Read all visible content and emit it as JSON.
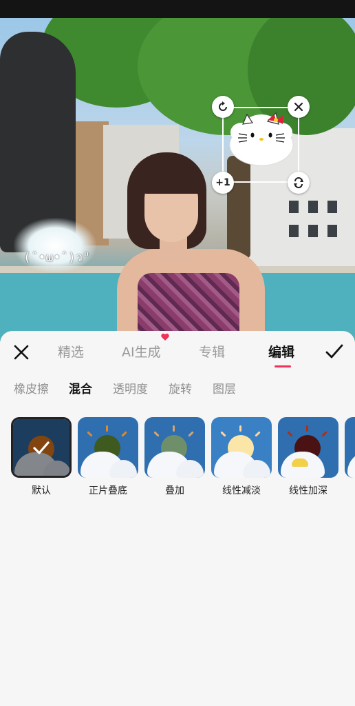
{
  "photo": {
    "kaomoji": "(ˆ•ω•ˆ)ว\""
  },
  "sticker": {
    "plus_label": "+1"
  },
  "main_tabs": [
    {
      "label": "精选",
      "active": false
    },
    {
      "label": "AI生成",
      "active": false,
      "badge": "heart"
    },
    {
      "label": "专辑",
      "active": false
    },
    {
      "label": "编辑",
      "active": true
    }
  ],
  "sub_tabs": [
    {
      "label": "橡皮擦",
      "active": false
    },
    {
      "label": "混合",
      "active": true
    },
    {
      "label": "透明度",
      "active": false
    },
    {
      "label": "旋转",
      "active": false
    },
    {
      "label": "图层",
      "active": false
    }
  ],
  "blend_modes": [
    {
      "label": "默认",
      "selected": true
    },
    {
      "label": "正片叠底",
      "selected": false
    },
    {
      "label": "叠加",
      "selected": false
    },
    {
      "label": "线性减淡",
      "selected": false
    },
    {
      "label": "线性加深",
      "selected": false
    },
    {
      "label": "",
      "selected": false
    }
  ],
  "colors": {
    "accent": "#f0325a",
    "text_active": "#111111",
    "text_inactive": "#9a9a9a",
    "thumb_sky": "#2f6fb0"
  },
  "icons": {
    "close": "close-icon",
    "confirm": "checkmark-icon",
    "rotate": "rotate-icon",
    "delete": "close-icon",
    "flip": "refresh-icon"
  }
}
